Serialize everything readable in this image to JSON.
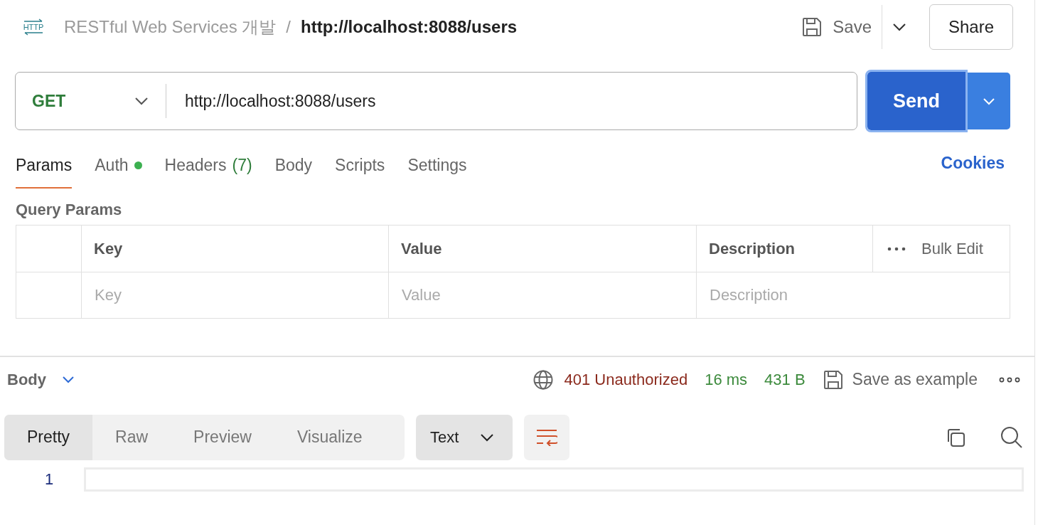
{
  "header": {
    "icon_label": "HTTP",
    "collection": "RESTful Web Services 개발",
    "separator": "/",
    "request_name": "http://localhost:8088/users",
    "save": "Save",
    "share": "Share"
  },
  "request": {
    "method": "GET",
    "url": "http://localhost:8088/users",
    "send": "Send"
  },
  "tabs": [
    {
      "label": "Params",
      "selected": true,
      "dot": false
    },
    {
      "label": "Auth",
      "selected": false,
      "dot": true
    },
    {
      "label": "Headers",
      "count": "(7)",
      "selected": false,
      "dot": false
    },
    {
      "label": "Body",
      "selected": false,
      "dot": false
    },
    {
      "label": "Scripts",
      "selected": false,
      "dot": false
    },
    {
      "label": "Settings",
      "selected": false,
      "dot": false
    }
  ],
  "cookies": "Cookies",
  "query_params": {
    "title": "Query Params",
    "columns": [
      "Key",
      "Value",
      "Description"
    ],
    "bulk_edit": "Bulk Edit",
    "placeholders": [
      "Key",
      "Value",
      "Description"
    ]
  },
  "response": {
    "title": "Body",
    "status": "401 Unauthorized",
    "time": "16 ms",
    "size": "431 B",
    "save_example": "Save as example",
    "views": [
      {
        "label": "Pretty",
        "selected": true
      },
      {
        "label": "Raw",
        "selected": false
      },
      {
        "label": "Preview",
        "selected": false
      },
      {
        "label": "Visualize",
        "selected": false
      }
    ],
    "format": "Text",
    "line_numbers": [
      "1"
    ]
  }
}
